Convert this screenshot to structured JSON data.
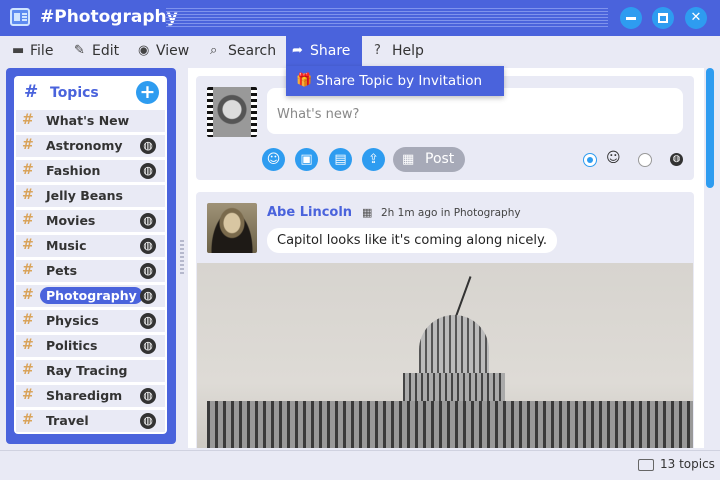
{
  "window": {
    "title": "#Photography"
  },
  "menu": {
    "file": "File",
    "edit": "Edit",
    "view": "View",
    "search": "Search",
    "share": "Share",
    "help": "Help"
  },
  "share_menu": {
    "invite": "Share Topic by Invitation"
  },
  "topics": {
    "title": "Topics",
    "hash": "#",
    "items": [
      {
        "name": "What's New",
        "public": false
      },
      {
        "name": "Astronomy",
        "public": true
      },
      {
        "name": "Fashion",
        "public": true
      },
      {
        "name": "Jelly Beans",
        "public": false
      },
      {
        "name": "Movies",
        "public": true
      },
      {
        "name": "Music",
        "public": true
      },
      {
        "name": "Pets",
        "public": true
      },
      {
        "name": "Photography",
        "public": true,
        "selected": true
      },
      {
        "name": "Physics",
        "public": true
      },
      {
        "name": "Politics",
        "public": true
      },
      {
        "name": "Ray Tracing",
        "public": false
      },
      {
        "name": "Sharedigm",
        "public": true
      },
      {
        "name": "Travel",
        "public": true
      }
    ]
  },
  "composer": {
    "placeholder": "What's new?",
    "post_label": "Post"
  },
  "post": {
    "author": "Abe Lincoln",
    "meta": "2h 1m ago in Photography",
    "text": "Capitol looks like it's coming along nicely."
  },
  "status": {
    "count": "13 topics"
  },
  "colors": {
    "accent": "#4a63dc",
    "button": "#2e9cf0",
    "hash": "#d9a35a",
    "panel": "#e9eaf5"
  }
}
